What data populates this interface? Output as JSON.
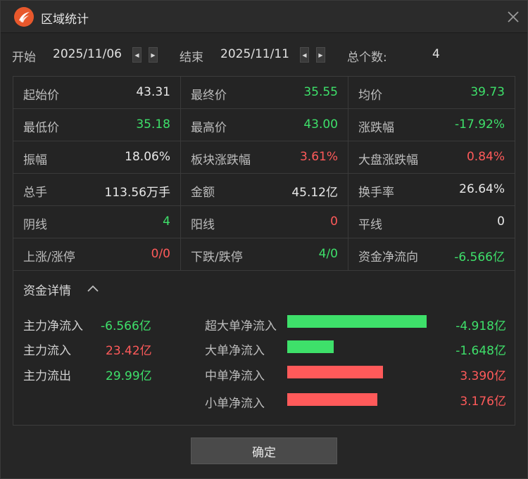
{
  "window": {
    "title": "区域统计"
  },
  "range": {
    "start_label": "开始",
    "start_value": "2025/11/06",
    "end_label": "结束",
    "end_value": "2025/11/11",
    "count_label": "总个数:",
    "count_value": "4"
  },
  "stats": [
    [
      {
        "label": "起始价",
        "value": "43.31",
        "color": "white"
      },
      {
        "label": "最终价",
        "value": "35.55",
        "color": "green"
      },
      {
        "label": "均价",
        "value": "39.73",
        "color": "green"
      }
    ],
    [
      {
        "label": "最低价",
        "value": "35.18",
        "color": "green"
      },
      {
        "label": "最高价",
        "value": "43.00",
        "color": "green"
      },
      {
        "label": "涨跌幅",
        "value": "-17.92%",
        "color": "green"
      }
    ],
    [
      {
        "label": "振幅",
        "value": "18.06%",
        "color": "white"
      },
      {
        "label": "板块涨跌幅",
        "value": "3.61%",
        "color": "red"
      },
      {
        "label": "大盘涨跌幅",
        "value": "0.84%",
        "color": "red"
      }
    ],
    [
      {
        "label": "总手",
        "value": "113.56万手",
        "color": "white"
      },
      {
        "label": "金额",
        "value": "45.12亿",
        "color": "white"
      },
      {
        "label": "换手率",
        "value": "26.64%",
        "color": "white"
      }
    ],
    [
      {
        "label": "阴线",
        "value": "4",
        "color": "green"
      },
      {
        "label": "阳线",
        "value": "0",
        "color": "red"
      },
      {
        "label": "平线",
        "value": "0",
        "color": "white"
      }
    ],
    [
      {
        "label": "上涨/涨停",
        "value": "0/0",
        "color": "red"
      },
      {
        "label": "下跌/跌停",
        "value": "4/0",
        "color": "green"
      },
      {
        "label": "资金净流向",
        "value": "-6.566亿",
        "color": "green"
      }
    ]
  ],
  "funds": {
    "title": "资金详情",
    "left": [
      {
        "label": "主力净流入",
        "value": "-6.566亿",
        "color": "green"
      },
      {
        "label": "主力流入",
        "value": "23.42亿",
        "color": "red"
      },
      {
        "label": "主力流出",
        "value": "29.99亿",
        "color": "green"
      }
    ],
    "flows": [
      {
        "label": "超大单净流入",
        "value": "-4.918亿",
        "amount": -4.918,
        "color": "green"
      },
      {
        "label": "大单净流入",
        "value": "-1.648亿",
        "amount": -1.648,
        "color": "green"
      },
      {
        "label": "中单净流入",
        "value": "3.390亿",
        "amount": 3.39,
        "color": "red"
      },
      {
        "label": "小单净流入",
        "value": "3.176亿",
        "amount": 3.176,
        "color": "red"
      }
    ]
  },
  "colors": {
    "green": "#3ee06a",
    "red": "#ff5a5a"
  },
  "ok_label": "确定"
}
